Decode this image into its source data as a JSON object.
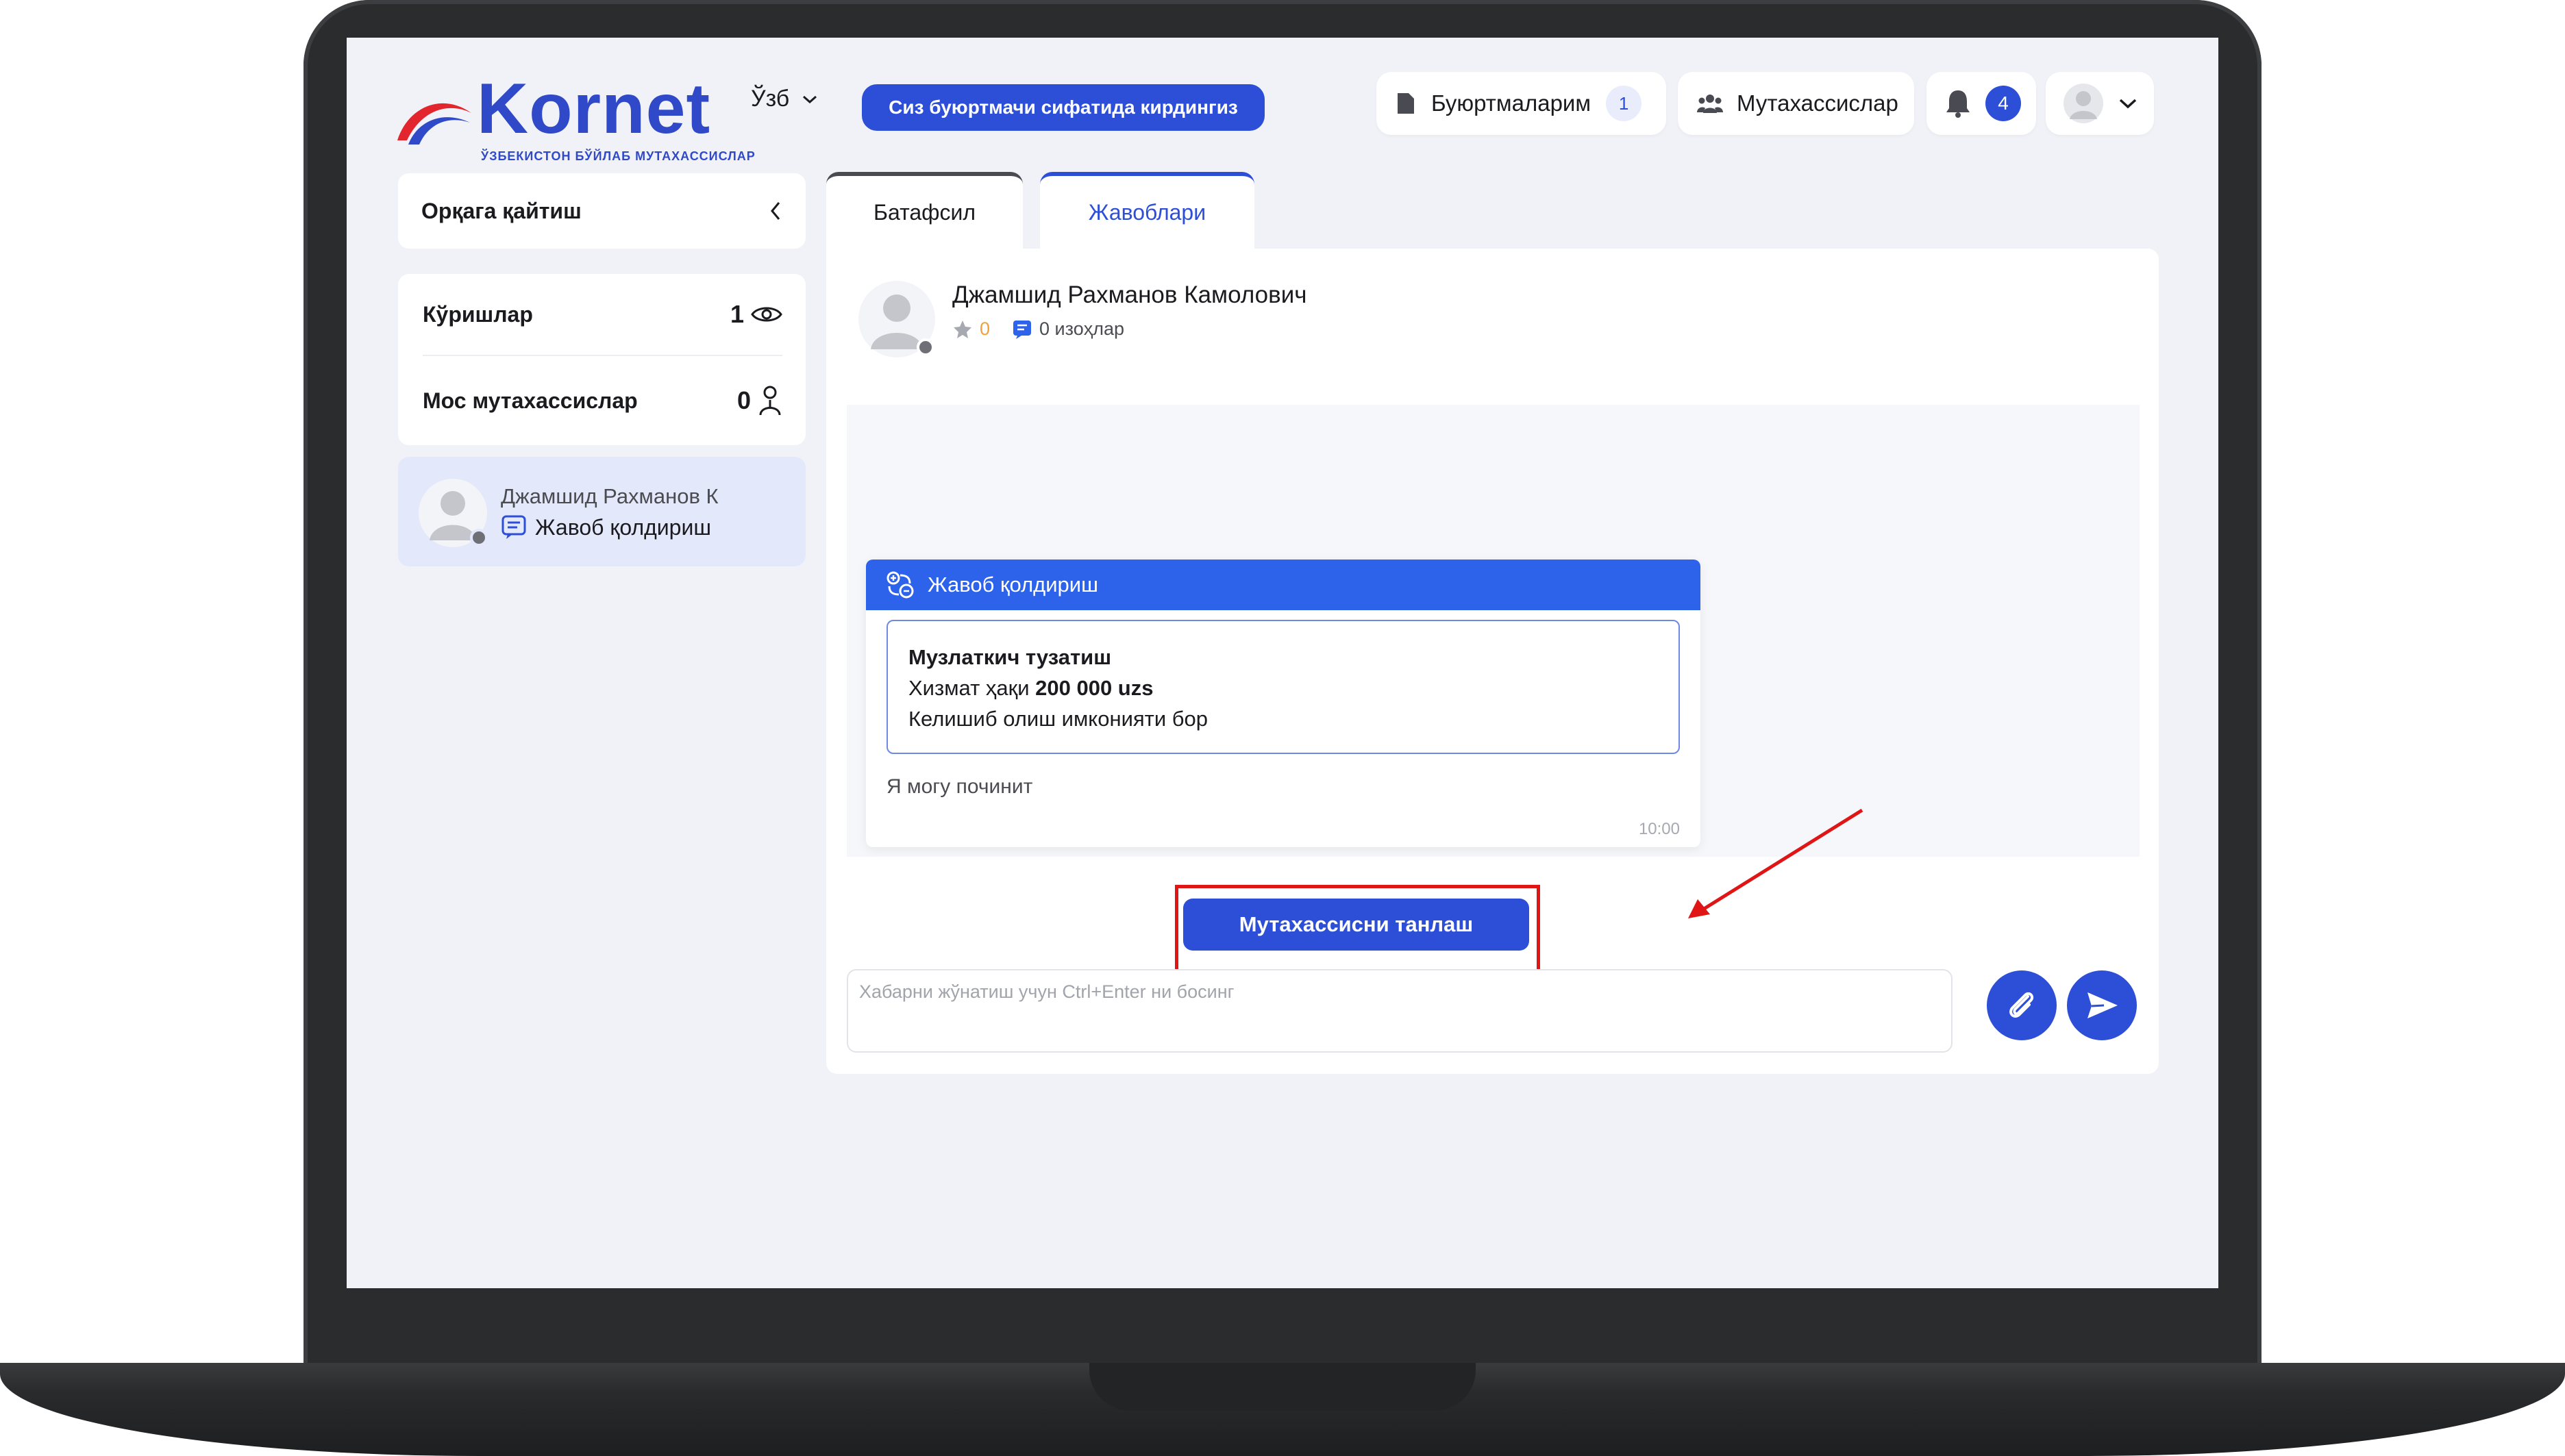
{
  "header": {
    "logo_text": "Kornet",
    "logo_subtitle": "ЎЗБЕКИСТОН БЎЙЛАБ МУТАХАССИСЛАР",
    "language": "Ўзб",
    "client_mode_label": "Сиз буюртмачи сифатида кирдингиз",
    "orders_label": "Буюртмаларим",
    "orders_count": "1",
    "specialists_label": "Мутахассислар",
    "notifications_count": "4"
  },
  "sidebar": {
    "back_label": "Орқага қайтиш",
    "stats": [
      {
        "label": "Кўришлар",
        "value": "1"
      },
      {
        "label": "Мос мутахассислар",
        "value": "0"
      }
    ],
    "chat_item": {
      "name": "Джамшид Рахманов К",
      "subtitle": "Жавоб қолдириш"
    }
  },
  "tabs": [
    {
      "label": "Батафсил",
      "active": false
    },
    {
      "label": "Жавоблари",
      "active": true
    }
  ],
  "chat": {
    "contact_name": "Джамшид Рахманов Камолович",
    "rating": "0",
    "comments": "0 изоҳлар",
    "message": {
      "header": "Жавоб қолдириш",
      "offer_title": "Музлаткич тузатиш",
      "price_prefix": "Хизмат ҳақи ",
      "price_value": "200 000 uzs",
      "contract_note": "Келишиб олиш имконияти бор",
      "text": "Я могу починит",
      "time": "10:00"
    },
    "choose_button_label": "Мутахассисни танлаш",
    "input_placeholder": "Хабарни жўнатиш учун Ctrl+Enter ни босинг"
  },
  "colors": {
    "accent": "#2d4fd8",
    "message_header": "#2d63ea",
    "highlight": "#e01616",
    "rating": "#f0a13a"
  }
}
